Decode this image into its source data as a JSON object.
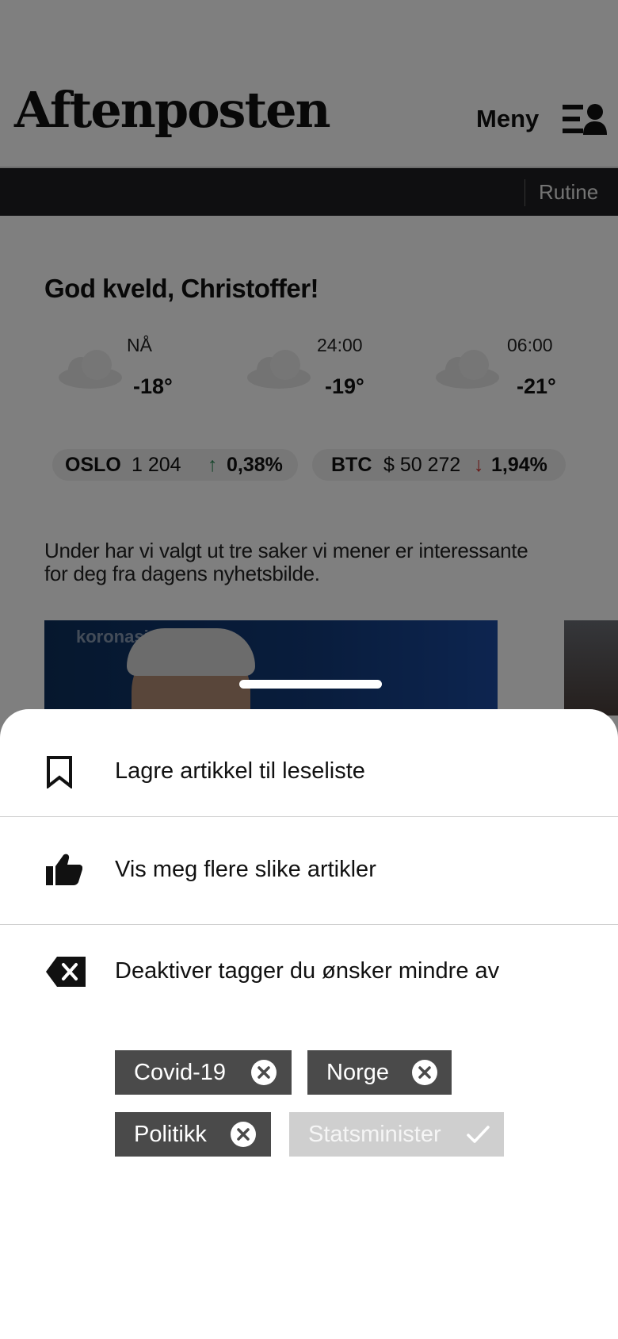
{
  "header": {
    "logo_text": "Aftenposten",
    "menu_label": "Meny",
    "menu_icon": "menu-person-icon"
  },
  "subbar": {
    "rutine_label": "Rutine"
  },
  "greeting": "God kveld, Christoffer!",
  "weather": [
    {
      "time": "NÅ",
      "temp": "-18°",
      "icon": "cloud-icon"
    },
    {
      "time": "24:00",
      "temp": "-19°",
      "icon": "cloud-icon"
    },
    {
      "time": "06:00",
      "temp": "-21°",
      "icon": "cloud-icon"
    }
  ],
  "tickers": [
    {
      "name": "OSLO",
      "value": "1 204",
      "direction": "up",
      "arrow": "↑",
      "change": "0,38%"
    },
    {
      "name": "BTC",
      "value": "$ 50 272",
      "direction": "down",
      "arrow": "↓",
      "change": "1,94%"
    }
  ],
  "intro_text": "Under har vi valgt ut tre saker vi mener er interessante for deg fra dagens nyhetsbilde.",
  "article_image_text": "koronasituasjonen",
  "sheet": {
    "items": [
      {
        "label": "Lagre artikkel til leseliste",
        "icon": "bookmark-icon"
      },
      {
        "label": "Vis meg flere slike artikler",
        "icon": "thumbs-up-icon"
      },
      {
        "label": "Deaktiver tagger du ønsker mindre av",
        "icon": "backspace-icon"
      }
    ],
    "tags": [
      {
        "label": "Covid-19",
        "state": "active"
      },
      {
        "label": "Norge",
        "state": "active"
      },
      {
        "label": "Politikk",
        "state": "active"
      },
      {
        "label": "Statsminister",
        "state": "deactivated"
      }
    ]
  },
  "colors": {
    "scrim": "#000000",
    "tag_active": "#4a4a4a",
    "tag_disabled": "#cfcfcf",
    "ticker_up": "#2e8b57",
    "ticker_down": "#d0312d"
  }
}
